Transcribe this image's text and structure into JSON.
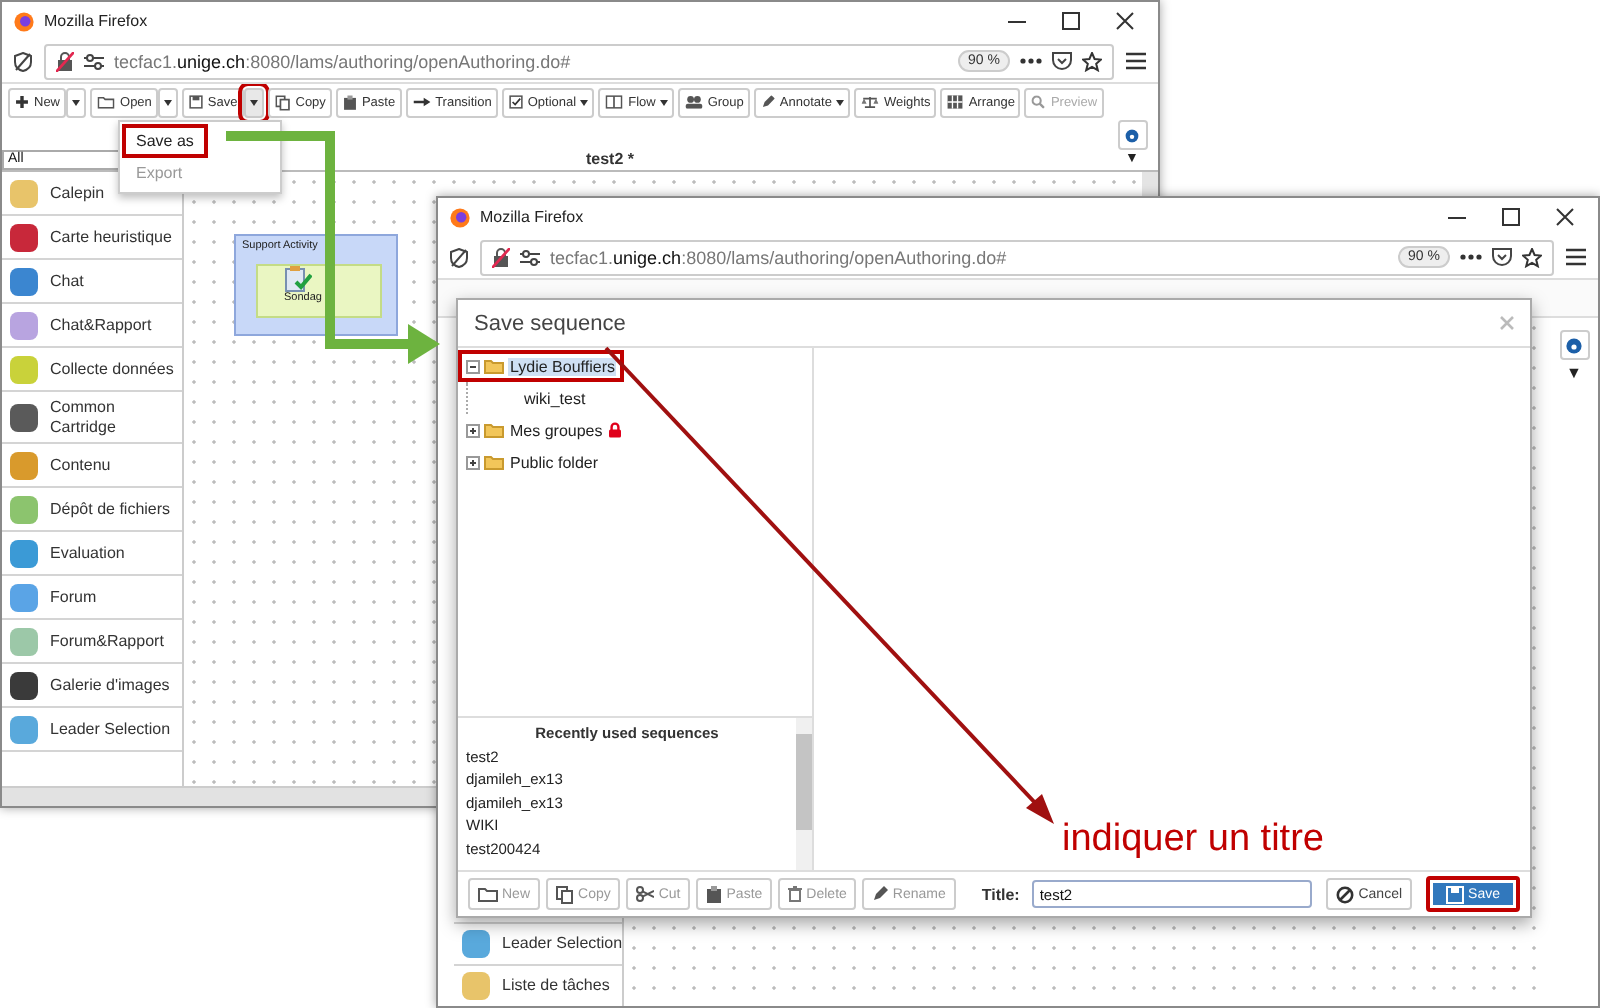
{
  "back_window": {
    "title": "Mozilla Firefox",
    "address": {
      "subdomain": "tecfac1.",
      "domain": "unige.ch",
      "path": ":8080/lams/authoring/openAuthoring.do#"
    },
    "zoom": "90 %",
    "toolbar": [
      {
        "kind": "button",
        "label": "New",
        "disabled": false,
        "highlighted": false
      },
      {
        "kind": "caret",
        "highlighted": false
      },
      {
        "kind": "button",
        "label": "Open",
        "disabled": false,
        "highlighted": false
      },
      {
        "kind": "caret",
        "highlighted": false
      },
      {
        "kind": "button",
        "label": "Save",
        "disabled": false,
        "highlighted": false
      },
      {
        "kind": "caret",
        "highlighted": true
      },
      {
        "kind": "button",
        "label": "Copy",
        "disabled": false,
        "highlighted": false
      },
      {
        "kind": "button",
        "label": "Paste",
        "disabled": false,
        "highlighted": false
      },
      {
        "kind": "button",
        "label": "Transition",
        "disabled": false,
        "highlighted": false
      },
      {
        "kind": "menu",
        "label": "Optional",
        "disabled": false,
        "highlighted": false
      },
      {
        "kind": "menu",
        "label": "Flow",
        "disabled": false,
        "highlighted": false
      },
      {
        "kind": "button",
        "label": "Group",
        "disabled": false,
        "highlighted": false
      },
      {
        "kind": "menu",
        "label": "Annotate",
        "disabled": false,
        "highlighted": false
      },
      {
        "kind": "button",
        "label": "Weights",
        "disabled": false,
        "highlighted": false
      },
      {
        "kind": "button",
        "label": "Arrange",
        "disabled": false,
        "highlighted": false
      },
      {
        "kind": "button",
        "label": "Preview",
        "disabled": true,
        "highlighted": false
      }
    ],
    "save_menu": [
      {
        "label": "Save as",
        "disabled": false,
        "highlighted": true
      },
      {
        "label": "Export",
        "disabled": true,
        "highlighted": false
      }
    ],
    "filter": "All",
    "sequence_title": "test2 *",
    "collapse_toggle": "▼",
    "palette": [
      "Calepin",
      "Carte heuristique",
      "Chat",
      "Chat&Rapport",
      "Collecte données",
      "Common Cartridge",
      "Contenu",
      "Dépôt de fichiers",
      "Evaluation",
      "Forum",
      "Forum&Rapport",
      "Galerie d'images",
      "Leader Selection"
    ],
    "canvas": {
      "group_title": "Support Activity",
      "activity": "Sondag"
    }
  },
  "front_window": {
    "title": "Mozilla Firefox",
    "address": {
      "subdomain": "tecfac1.",
      "domain": "unige.ch",
      "path": ":8080/lams/authoring/openAuthoring.do#"
    },
    "zoom": "90 %",
    "collapse_toggle": "▼",
    "palette": [
      "Leader Selection",
      "Liste de tâches"
    ],
    "dialog": {
      "title": "Save sequence",
      "tree": [
        {
          "kind": "folder",
          "label": "Lydie Bouffiers",
          "expanded": true,
          "selected": true,
          "highlighted": true,
          "locked": false,
          "children": [
            {
              "kind": "sequence",
              "label": "wiki_test",
              "selected": false,
              "highlighted": false,
              "locked": false
            }
          ]
        },
        {
          "kind": "folder",
          "label": "Mes groupes",
          "expanded": false,
          "selected": false,
          "highlighted": false,
          "locked": true
        },
        {
          "kind": "folder",
          "label": "Public folder",
          "expanded": false,
          "selected": false,
          "highlighted": false,
          "locked": false
        }
      ],
      "recent": {
        "title": "Recently used sequences",
        "items": [
          "test2",
          "djamileh_ex13",
          "djamileh_ex13",
          "WIKI",
          "test200424"
        ]
      },
      "actions": [
        {
          "label": "New",
          "disabled": true
        },
        {
          "label": "Copy",
          "disabled": true
        },
        {
          "label": "Cut",
          "disabled": true
        },
        {
          "label": "Paste",
          "disabled": true
        },
        {
          "label": "Delete",
          "disabled": true
        },
        {
          "label": "Rename",
          "disabled": true
        }
      ],
      "title_field": {
        "label": "Title:",
        "value": "test2"
      },
      "cancel": "Cancel",
      "save": {
        "label": "Save",
        "highlighted": true
      }
    }
  },
  "annotation": {
    "note": "indiquer un titre"
  }
}
